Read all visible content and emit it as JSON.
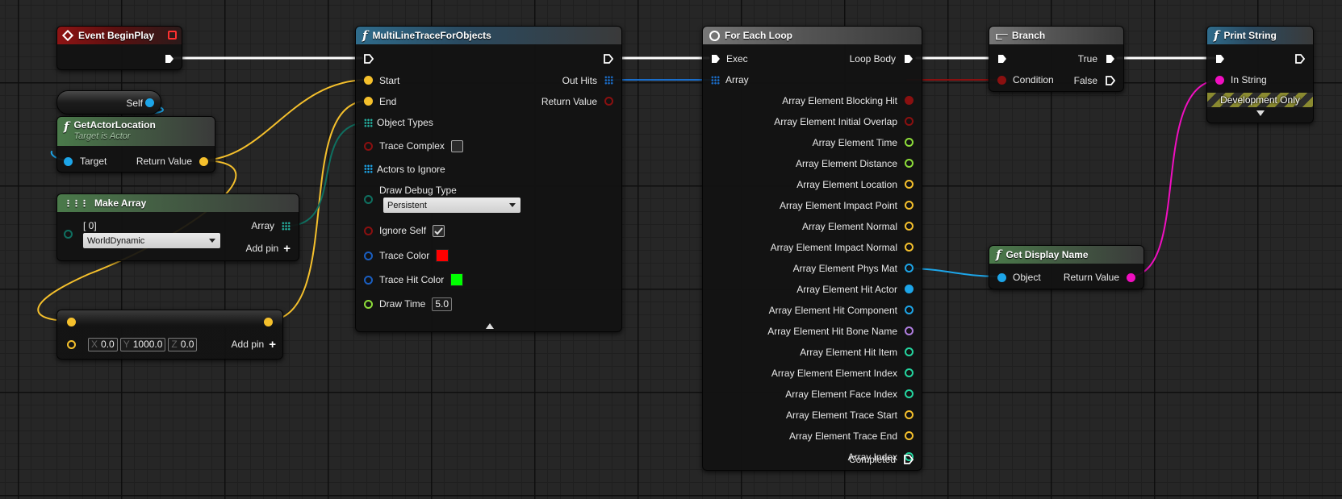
{
  "colors": {
    "exec": "#ffffff",
    "vector": "#f5c02c",
    "object": "#1da5e8",
    "boolean": "#8a1010",
    "struct": "#1a6ecb",
    "enum": "#0f6f60",
    "float": "#8ddc3a",
    "string": "#f00fc0",
    "integer": "#25d6a0",
    "name": "#b07ee0",
    "trace_color": "#ff0000",
    "trace_hit_color": "#00ff00"
  },
  "nodes": {
    "event_begin_play": {
      "title": "Event BeginPlay",
      "icon": "event-diamond-icon"
    },
    "self": {
      "label": "Self"
    },
    "get_actor_location": {
      "title": "GetActorLocation",
      "subtitle": "Target is Actor",
      "target": "Target",
      "return_value": "Return Value"
    },
    "make_array": {
      "title": "Make Array",
      "index_label": "[ 0]",
      "selected": "WorldDynamic",
      "array": "Array",
      "add_pin": "Add pin"
    },
    "make_vector": {
      "x_label": "X",
      "x": "0.0",
      "y_label": "Y",
      "y": "1000.0",
      "z_label": "Z",
      "z": "0.0",
      "add_pin": "Add pin"
    },
    "multi_line_trace": {
      "title": "MultiLineTraceForObjects",
      "start": "Start",
      "end": "End",
      "object_types": "Object Types",
      "trace_complex": "Trace Complex",
      "actors_to_ignore": "Actors to Ignore",
      "draw_debug_type": "Draw Debug Type",
      "draw_debug_value": "Persistent",
      "ignore_self": "Ignore Self",
      "trace_color": "Trace Color",
      "trace_hit_color": "Trace Hit Color",
      "draw_time": "Draw Time",
      "draw_time_value": "5.0",
      "out_hits": "Out Hits",
      "return_value": "Return Value"
    },
    "for_each_loop": {
      "title": "For Each Loop",
      "exec": "Exec",
      "array": "Array",
      "loop_body": "Loop Body",
      "outputs": [
        "Array Element Blocking Hit",
        "Array Element Initial Overlap",
        "Array Element Time",
        "Array Element Distance",
        "Array Element Location",
        "Array Element Impact Point",
        "Array Element Normal",
        "Array Element Impact Normal",
        "Array Element Phys Mat",
        "Array Element Hit Actor",
        "Array Element Hit Component",
        "Array Element Hit Bone Name",
        "Array Element Hit Item",
        "Array Element Element Index",
        "Array Element Face Index",
        "Array Element Trace Start",
        "Array Element Trace End",
        "Array Index"
      ],
      "completed": "Completed"
    },
    "branch": {
      "title": "Branch",
      "condition": "Condition",
      "true": "True",
      "false": "False"
    },
    "print_string": {
      "title": "Print String",
      "in_string": "In String",
      "dev_only": "Development Only"
    },
    "get_display_name": {
      "title": "Get Display Name",
      "object": "Object",
      "return_value": "Return Value"
    }
  }
}
